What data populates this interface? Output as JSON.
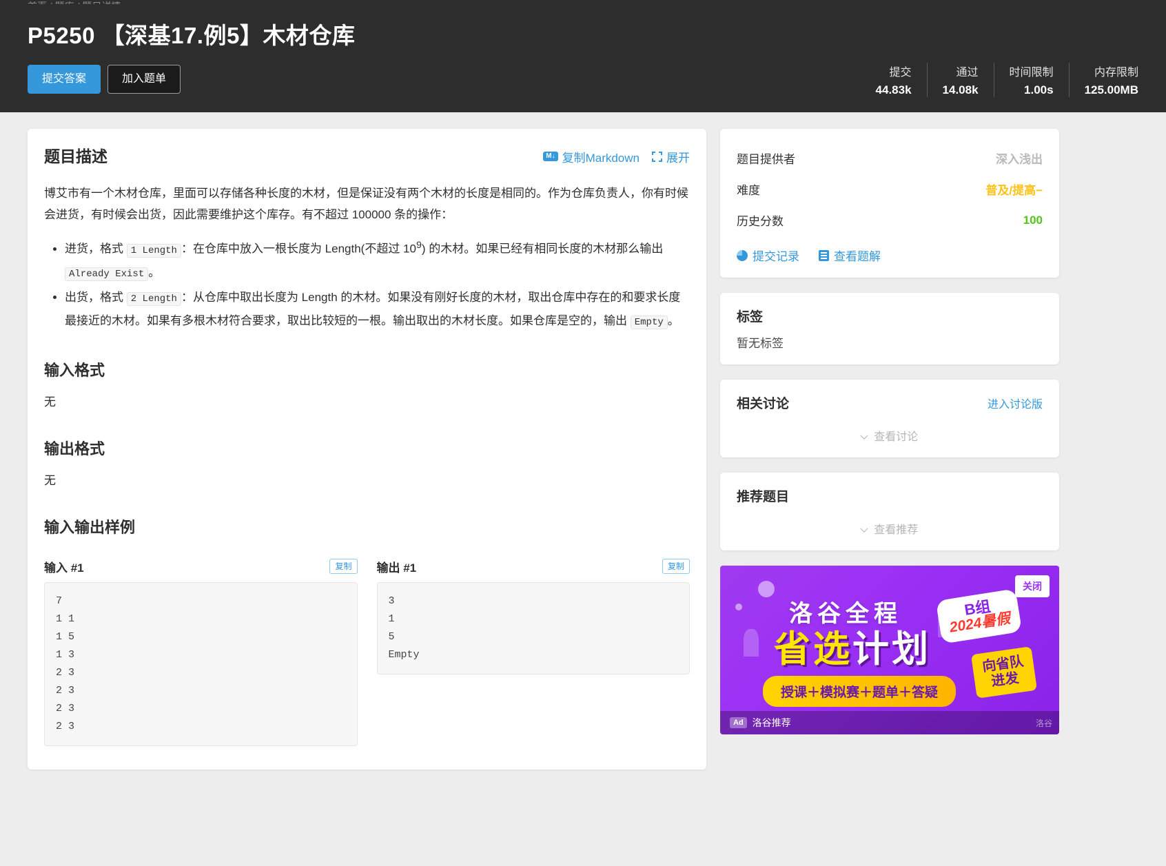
{
  "header": {
    "breadcrumb": "首页 / 题库 / 题目详情",
    "title": "P5250 【深基17.例5】木材仓库",
    "submit_button": "提交答案",
    "add_list_button": "加入题单",
    "stats": [
      {
        "label": "提交",
        "value": "44.83k"
      },
      {
        "label": "通过",
        "value": "14.08k"
      },
      {
        "label": "时间限制",
        "value": "1.00s"
      },
      {
        "label": "内存限制",
        "value": "125.00MB"
      }
    ]
  },
  "problem": {
    "description_title": "题目描述",
    "copy_markdown_label": "复制Markdown",
    "copy_markdown_icon": "markdown-icon",
    "expand_label": "展开",
    "expand_icon": "expand-icon",
    "intro": "博艾市有一个木材仓库，里面可以存储各种长度的木材，但是保证没有两个木材的长度是相同的。作为仓库负责人，你有时候会进货，有时候会出货，因此需要维护这个库存。有不超过 100000 条的操作：",
    "ops": [
      {
        "p1": "进货，格式",
        "code": "1 Length",
        "p2": "：在仓库中放入一根长度为 Length(不超过 10",
        "sup": "9",
        "p3": ") 的木材。如果已经有相同长度的木材那么输出",
        "code2": "Already Exist",
        "p4": "。"
      },
      {
        "p1": "出货，格式",
        "code": "2 Length",
        "p2": "：从仓库中取出长度为 Length 的木材。如果没有刚好长度的木材，取出仓库中存在的和要求长度最接近的木材。如果有多根木材符合要求，取出比较短的一根。输出取出的木材长度。如果仓库是空的，输出",
        "code2": "Empty",
        "p4": "。"
      }
    ],
    "input_format_title": "输入格式",
    "input_format_body": "无",
    "output_format_title": "输出格式",
    "output_format_body": "无",
    "samples_title": "输入输出样例",
    "samples": [
      {
        "title": "输入 #1",
        "copy_label": "复制",
        "code": "7\n1 1\n1 5\n1 3\n2 3\n2 3\n2 3\n2 3"
      },
      {
        "title": "输出 #1",
        "copy_label": "复制",
        "code": "3\n1\n5\nEmpty"
      }
    ]
  },
  "sidebar": {
    "info": {
      "rows": [
        {
          "key": "题目提供者",
          "value": "深入浅出",
          "style": "val-gray"
        },
        {
          "key": "难度",
          "value": "普及/提高−",
          "style": "val-orange"
        },
        {
          "key": "历史分数",
          "value": "100",
          "style": "val-green"
        }
      ],
      "links": [
        {
          "label": "提交记录",
          "icon": "pie-chart-icon"
        },
        {
          "label": "查看题解",
          "icon": "book-icon"
        }
      ]
    },
    "tags": {
      "title": "标签",
      "empty_text": "暂无标签"
    },
    "discussion": {
      "title": "相关讨论",
      "action_label": "进入讨论版",
      "collapse_label": "查看讨论",
      "collapse_icon": "chevron-down-icon"
    },
    "recommend": {
      "title": "推荐题目",
      "collapse_label": "查看推荐",
      "collapse_icon": "chevron-down-icon"
    },
    "ad": {
      "close_label": "关闭",
      "line1": "洛谷全程",
      "line2_yellow": "省选",
      "line2_white": "计划",
      "bubble_top": "B组",
      "bubble_bottom": "2024暑假",
      "strip": "授课＋模拟赛＋题单＋答疑",
      "tag2_l1": "向省队",
      "tag2_l2": "进发",
      "footer_badge": "Ad",
      "footer_text": "洛谷推荐",
      "corner": "洛谷"
    }
  },
  "colors": {
    "accent": "#3498db",
    "header_bg": "#2d2d2d",
    "orange": "#ffc116",
    "green": "#52c41a",
    "ad_purple": "#9b30f5"
  }
}
